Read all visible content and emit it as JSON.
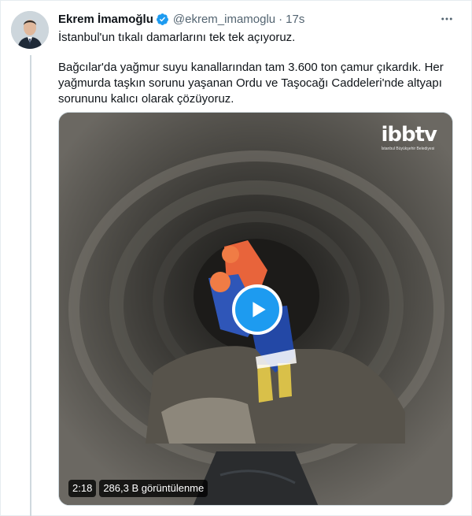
{
  "tweet": {
    "display_name": "Ekrem İmamoğlu",
    "handle": "@ekrem_imamoglu",
    "separator": "·",
    "time": "17s",
    "line1": "İstanbul'un tıkalı damarlarını tek tek açıyoruz.",
    "line2": "Bağcılar'da yağmur suyu kanallarından tam 3.600 ton çamur çıkardık. Her yağmurda taşkın sorunu yaşanan Ordu ve Taşocağı Caddeleri'nde altyapı sorununu kalıcı olarak çözüyoruz."
  },
  "video": {
    "logo": "ibbtv",
    "logo_subtitle": "İstanbul Büyükşehir Belediyesi",
    "duration": "2:18",
    "views": "286,3 B görüntülenme"
  },
  "icons": {
    "verified": "verified-badge-icon",
    "more": "more-options-icon",
    "play": "play-icon"
  },
  "colors": {
    "verified": "#1d9bf0",
    "play_button": "#1d9bf0",
    "text": "#0f1419",
    "secondary_text": "#536471"
  }
}
